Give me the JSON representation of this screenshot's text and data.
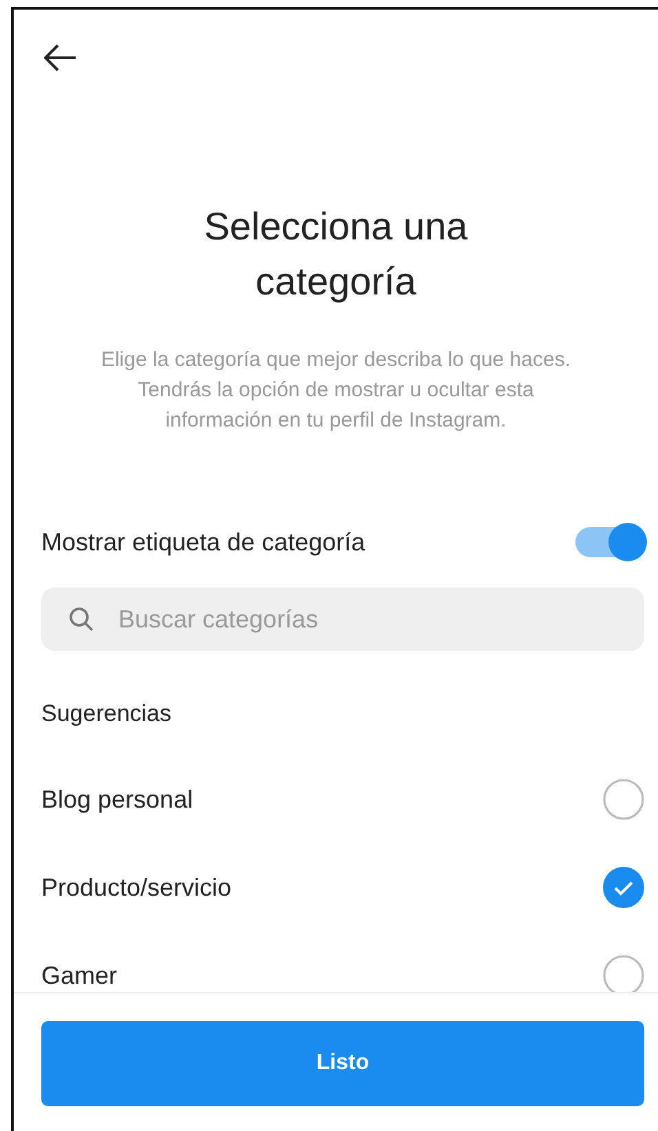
{
  "title": "Selecciona una categoría",
  "description": "Elige la categoría que mejor describa lo que haces. Tendrás la opción de mostrar u ocultar esta información en tu perfil de Instagram.",
  "toggle": {
    "label": "Mostrar etiqueta de categoría",
    "on": true
  },
  "search": {
    "placeholder": "Buscar categorías"
  },
  "section": "Sugerencias",
  "options": [
    {
      "label": "Blog personal",
      "selected": false
    },
    {
      "label": "Producto/servicio",
      "selected": true
    },
    {
      "label": "Gamer",
      "selected": false
    }
  ],
  "button": "Listo"
}
